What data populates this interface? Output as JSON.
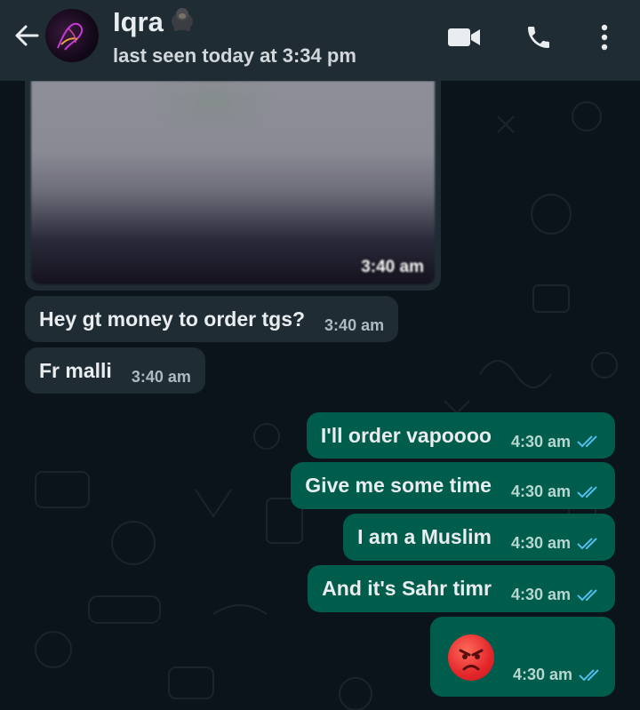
{
  "header": {
    "contact_name": "Iqra",
    "name_emoji_icon": "gorilla-emoji-icon",
    "status": "last seen today at 3:34 pm",
    "icons": [
      "back-arrow-icon",
      "video-call-icon",
      "phone-call-icon",
      "more-options-icon"
    ]
  },
  "messages": [
    {
      "direction": "incoming",
      "type": "image",
      "time": "3:40 am"
    },
    {
      "direction": "incoming",
      "text": "Hey gt money to order tgs?",
      "time": "3:40 am"
    },
    {
      "direction": "incoming",
      "text": "Fr malli",
      "time": "3:40 am"
    },
    {
      "direction": "outgoing",
      "text": "I'll order vapoooo",
      "time": "4:30 am",
      "status": "read"
    },
    {
      "direction": "outgoing",
      "text": "Give me some time",
      "time": "4:30 am",
      "status": "read"
    },
    {
      "direction": "outgoing",
      "text": "I am a Muslim",
      "time": "4:30 am",
      "status": "read"
    },
    {
      "direction": "outgoing",
      "text": "And it's Sahr timr",
      "time": "4:30 am",
      "status": "read"
    },
    {
      "direction": "outgoing",
      "type": "emoji",
      "emoji_icon": "angry-face-emoji-icon",
      "time": "4:30 am",
      "status": "read"
    }
  ],
  "colors": {
    "header_bg": "#1f2c34",
    "chat_bg": "#0b141a",
    "incoming_bubble": "#1f2c34",
    "outgoing_bubble": "#005c4b",
    "read_ticks": "#53bdeb"
  }
}
